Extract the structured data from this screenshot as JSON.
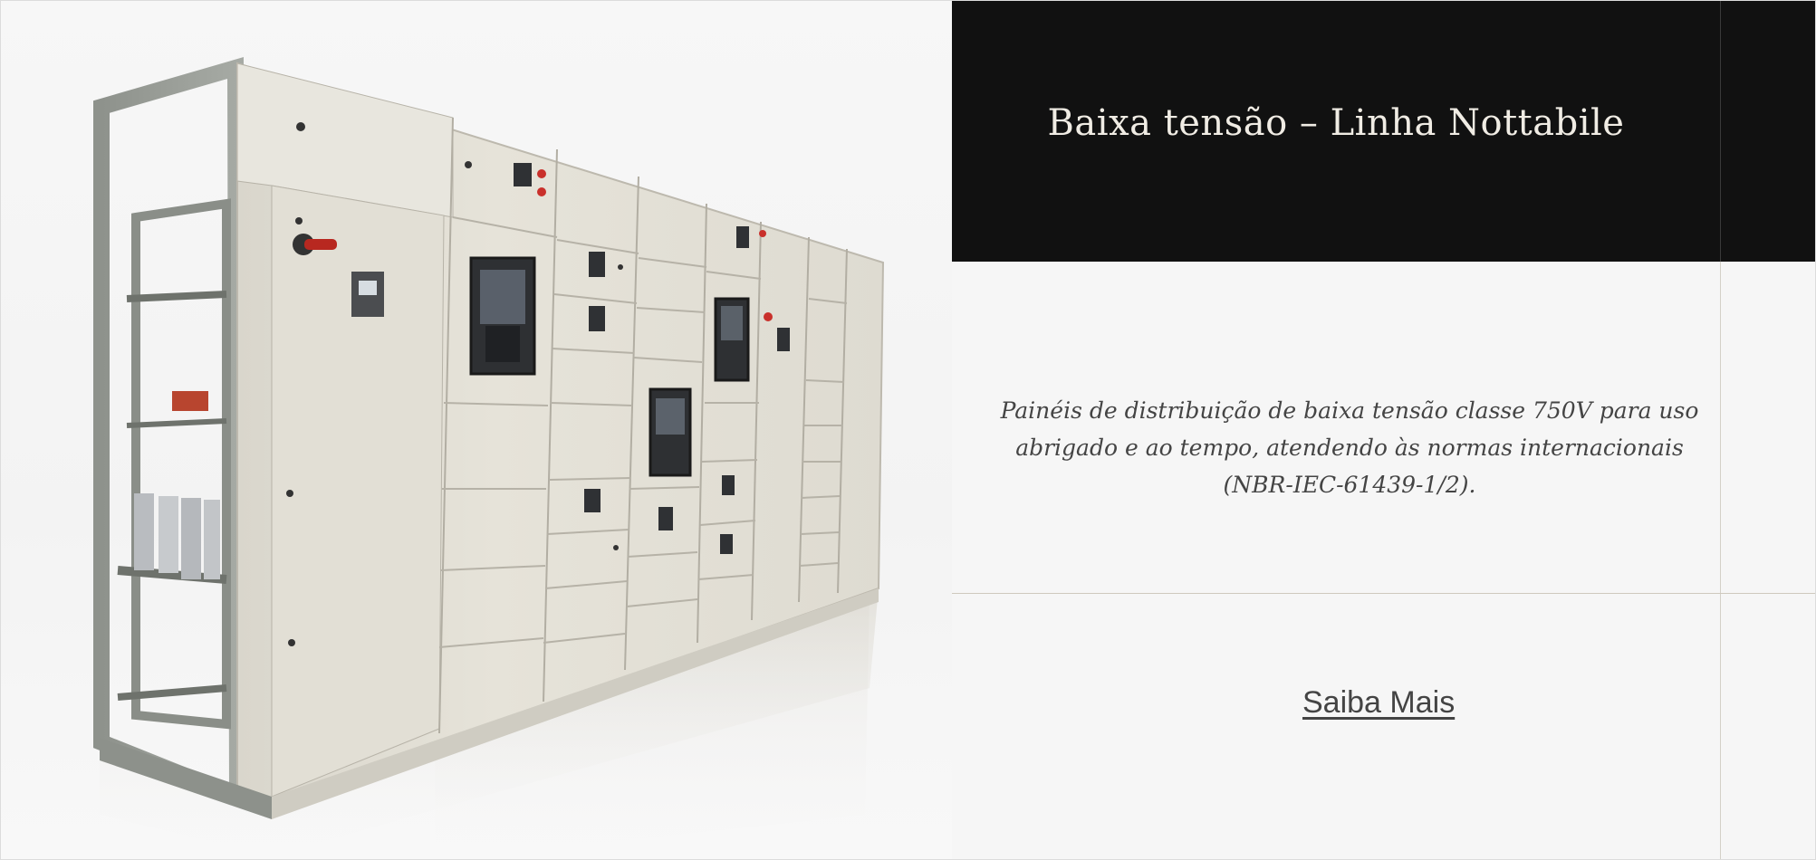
{
  "hero": {
    "title": "Baixa tensão – Linha Nottabile",
    "description": "Painéis de distribuição de baixa tensão classe 750V para uso abrigado e ao tempo, atendendo às normas internacionais (NBR-IEC-61439-1/2).",
    "cta_label": "Saiba Mais",
    "image_subject": "low-voltage-switchgear-panel"
  },
  "colors": {
    "title_bg": "#111111",
    "title_text": "#f0ece4",
    "page_bg": "#f6f6f6",
    "body_text": "#444444"
  }
}
